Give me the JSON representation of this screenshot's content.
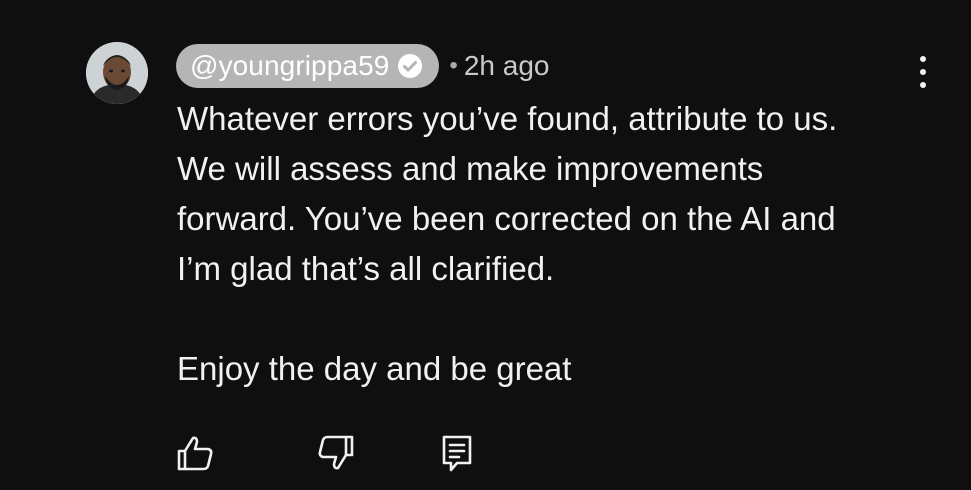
{
  "comment": {
    "author": "@youngrippa59",
    "verified": true,
    "separator": "•",
    "timestamp": "2h ago",
    "text": "Whatever errors you’ve found, attribute to us.\nWe will assess and make improvements\nforward. You’ve been corrected on the AI and\nI’m glad that’s all clarified.\n\nEnjoy the day and be great"
  },
  "actions": {
    "like_icon": "thumbs-up-icon",
    "dislike_icon": "thumbs-down-icon",
    "reply_icon": "reply-comment-icon",
    "more_icon": "more-vertical-icon"
  },
  "colors": {
    "background": "#0f0f0f",
    "text": "#f1f1f1",
    "author_pill": "#b5b5b5",
    "secondary_text": "#aaaaaa"
  }
}
